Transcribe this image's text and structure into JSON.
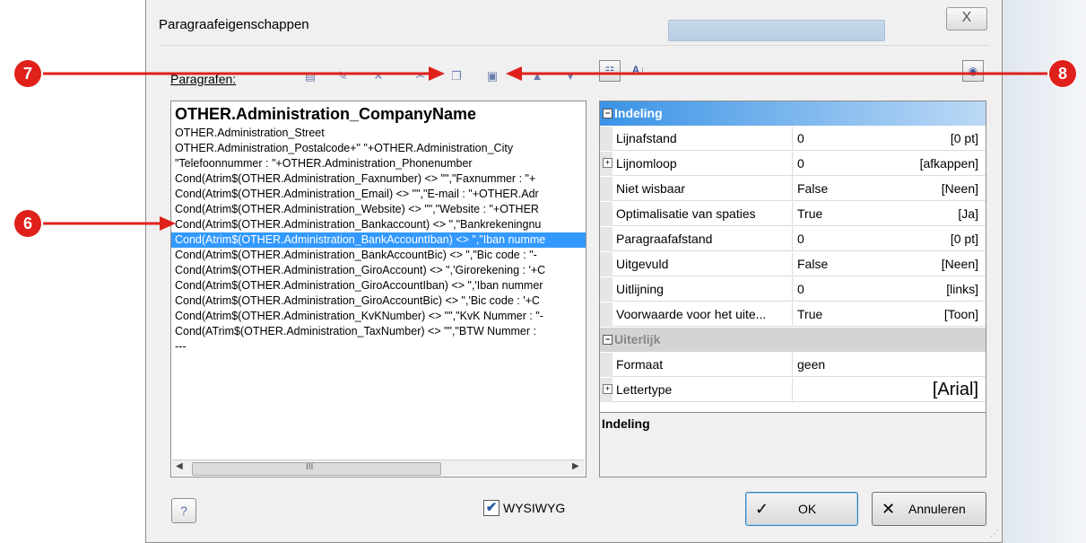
{
  "dialog": {
    "title": "Paragraafeigenschappen",
    "close_symbol": "X"
  },
  "paragraphs": {
    "label": "Paragrafen:",
    "toolbar_icons": [
      "new-paragraph-icon",
      "edit-paragraph-icon",
      "delete-icon",
      "cut-icon",
      "copy-icon",
      "paste-icon",
      "move-up-icon",
      "move-down-icon"
    ],
    "heading": "OTHER.Administration_CompanyName",
    "lines": [
      "OTHER.Administration_Street",
      "OTHER.Administration_Postalcode+\"    \"+OTHER.Administration_City",
      "\"Telefoonnummer : \"+OTHER.Administration_Phonenumber",
      "Cond(Atrim$(OTHER.Administration_Faxnumber) <> \"\",\"Faxnummer : \"+",
      "Cond(Atrim$(OTHER.Administration_Email) <> \"\",\"E-mail : \"+OTHER.Adr",
      "Cond(Atrim$(OTHER.Administration_Website) <> \"\",\"Website : \"+OTHER",
      "Cond(Atrim$(OTHER.Administration_Bankaccount) <> \",\"Bankrekeningnu",
      "Cond(Atrim$(OTHER.Administration_BankAccountIban) <> \",\"Iban numme",
      "Cond(Atrim$(OTHER.Administration_BankAccountBic) <> \",\"Bic code : \"-",
      "Cond(Atrim$(OTHER.Administration_GiroAccount) <> \",'Girorekening : '+C",
      "Cond(Atrim$(OTHER.Administration_GiroAccountIban) <> \",'Iban nummer",
      "Cond(Atrim$(OTHER.Administration_GiroAccountBic) <> \",'Bic code : '+C",
      "Cond(Atrim$(OTHER.Administration_KvKNumber) <> \"\",\"KvK Nummer : \"-",
      "Cond(ATrim$(OTHER.Administration_TaxNumber) <> \"\",\"BTW Nummer :",
      "---"
    ],
    "selected_index": 7,
    "scroll_thumb_glyph": "III"
  },
  "properties": {
    "categories": [
      {
        "name": "Indeling",
        "expander": "⊟",
        "rows": [
          {
            "name": "Lijnafstand",
            "value": "0",
            "unit": "[0 pt]",
            "expander": ""
          },
          {
            "name": "Lijnomloop",
            "value": "0",
            "unit": "[afkappen]",
            "expander": "+"
          },
          {
            "name": "Niet wisbaar",
            "value": "False",
            "unit": "[Neen]",
            "expander": ""
          },
          {
            "name": "Optimalisatie van spaties",
            "value": "True",
            "unit": "[Ja]",
            "expander": ""
          },
          {
            "name": "Paragraafafstand",
            "value": "0",
            "unit": "[0 pt]",
            "expander": ""
          },
          {
            "name": "Uitgevuld",
            "value": "False",
            "unit": "[Neen]",
            "expander": ""
          },
          {
            "name": "Uitlijning",
            "value": "0",
            "unit": "[links]",
            "expander": ""
          },
          {
            "name": "Voorwaarde voor het uite...",
            "value": "True",
            "unit": "[Toon]",
            "expander": ""
          }
        ]
      },
      {
        "name": "Uiterlijk",
        "expander": "⊟",
        "rows": [
          {
            "name": "Formaat",
            "value": "geen",
            "unit": "",
            "expander": ""
          },
          {
            "name": "Lettertype",
            "value": "",
            "unit": "[Arial]",
            "expander": "+"
          }
        ]
      }
    ],
    "description_title": "Indeling"
  },
  "footer": {
    "help_symbol": "?",
    "wysiwyg_label": "WYSIWYG",
    "wysiwyg_checked": true,
    "ok_label": "OK",
    "cancel_label": "Annuleren"
  },
  "callouts": [
    {
      "number": "6",
      "color": "#e0201b"
    },
    {
      "number": "7",
      "color": "#e0201b"
    },
    {
      "number": "8",
      "color": "#e0201b"
    }
  ],
  "colors": {
    "selection": "#3399ff",
    "category_active": "#3a93e6",
    "callout": "#e0201b"
  }
}
